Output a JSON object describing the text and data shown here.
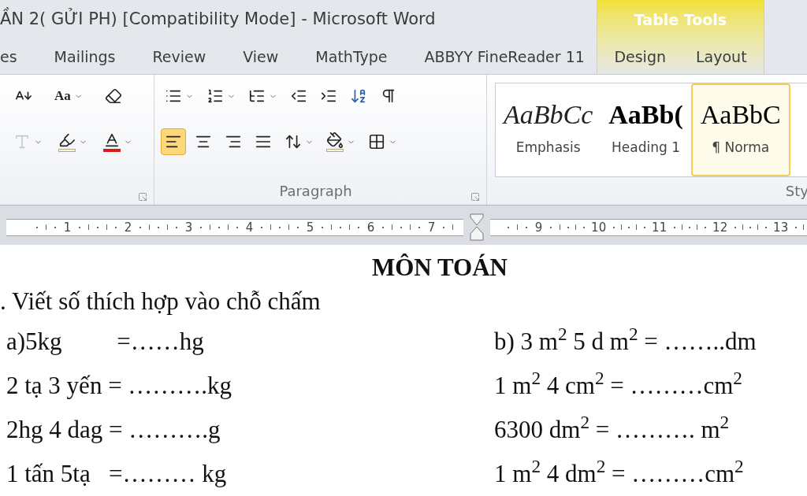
{
  "window": {
    "title": "ẦN 2( GỬI PH) [Compatibility Mode]  -  Microsoft Word"
  },
  "contextual_group": {
    "title": "Table Tools"
  },
  "tabs": [
    {
      "label": "es",
      "kind": "standard",
      "selected": false
    },
    {
      "label": "Mailings",
      "kind": "standard",
      "selected": false
    },
    {
      "label": "Review",
      "kind": "standard",
      "selected": false
    },
    {
      "label": "View",
      "kind": "standard",
      "selected": false
    },
    {
      "label": "MathType",
      "kind": "standard",
      "selected": false
    },
    {
      "label": "ABBYY FineReader 11",
      "kind": "standard",
      "selected": false
    },
    {
      "label": "Design",
      "kind": "contextual",
      "selected": false
    },
    {
      "label": "Layout",
      "kind": "contextual",
      "selected": false
    }
  ],
  "ribbon": {
    "font_group": {
      "row_1": [
        {
          "kind": "shrink-font",
          "dropdown": false
        },
        {
          "kind": "change-case",
          "text": "Aa",
          "dropdown": true
        },
        {
          "kind": "clear-formatting",
          "dropdown": false
        }
      ],
      "row_2": [
        {
          "kind": "text-effects",
          "dropdown": true,
          "disabled": true
        },
        {
          "kind": "highlight",
          "dropdown": true,
          "disabled": false
        },
        {
          "kind": "font-color",
          "dropdown": true,
          "disabled": false
        }
      ]
    },
    "paragraph_group": {
      "label": "Paragraph",
      "row_1": [
        {
          "kind": "bullets",
          "dropdown": true
        },
        {
          "kind": "numbering",
          "dropdown": true
        },
        {
          "kind": "multilevel-list",
          "dropdown": true
        },
        {
          "kind": "decrease-indent",
          "dropdown": false
        },
        {
          "kind": "increase-indent",
          "dropdown": false
        },
        {
          "kind": "sort",
          "dropdown": false
        },
        {
          "kind": "show-marks",
          "dropdown": false
        }
      ],
      "row_2": [
        {
          "kind": "align-left",
          "dropdown": false,
          "selected": true
        },
        {
          "kind": "align-center",
          "dropdown": false,
          "selected": false
        },
        {
          "kind": "align-right",
          "dropdown": false,
          "selected": false
        },
        {
          "kind": "justify",
          "dropdown": false,
          "selected": false
        },
        {
          "kind": "line-spacing",
          "dropdown": true,
          "selected": false
        },
        {
          "kind": "shading",
          "dropdown": true,
          "selected": false
        },
        {
          "kind": "borders",
          "dropdown": true,
          "selected": false
        }
      ]
    },
    "styles_group": {
      "label": "Sty",
      "styles": [
        {
          "preview": "AaBbCc",
          "name": "Emphasis",
          "kind": "emphasis",
          "selected": false
        },
        {
          "preview": "AaBb(",
          "name": "Heading 1",
          "kind": "heading",
          "selected": false
        },
        {
          "preview": "AaBbC",
          "name": "¶ Norma",
          "kind": "normal",
          "selected": true
        }
      ]
    }
  },
  "ruler": {
    "left_numbers": [
      "1",
      "2",
      "3",
      "4",
      "5",
      "6",
      "7"
    ],
    "right_numbers": [
      "9",
      "10",
      "11",
      "12",
      "13"
    ]
  },
  "document": {
    "title": "MÔN TOÁN",
    "question": ". Viết số thích hợp vào chỗ chấm",
    "rows": [
      {
        "left": "a)5kg         =……hg",
        "right": "b) 3 m$^{2}$ 5 d m$^{2}$ = ……..dm"
      },
      {
        "left": "2 tạ 3 yến = ……….kg",
        "right": "1 m$^{2}$ 4 cm$^{2}$ = ………cm$^{2}$"
      },
      {
        "left": "2hg 4 dag = ……….g",
        "right": "6300 dm$^{2}$ = ………. m$^{2}$"
      },
      {
        "left": "1 tấn 5tạ   =……… kg",
        "right": "1 m$^{2}$ 4 dm$^{2}$ = ………cm$^{2}$"
      }
    ]
  }
}
